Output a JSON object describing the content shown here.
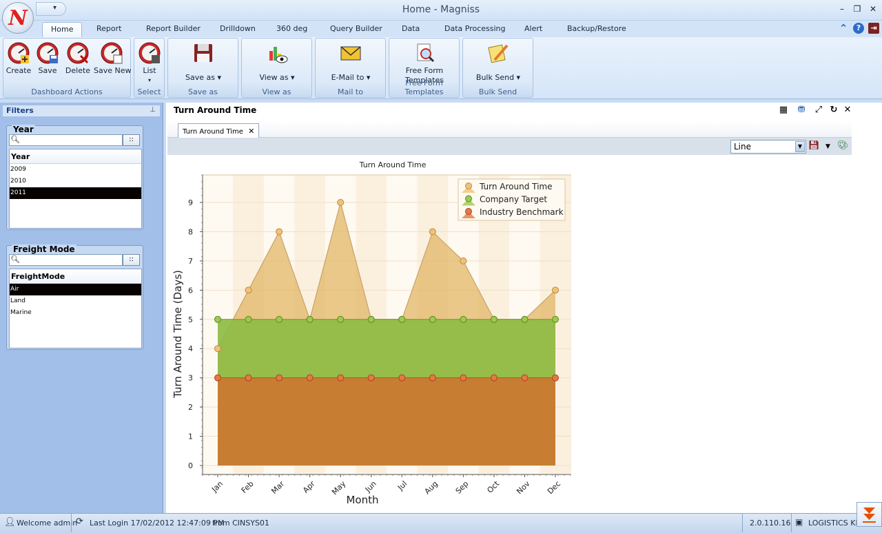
{
  "window": {
    "title": "Home - Magniss",
    "logo_letter": "N",
    "qat_arrow": "▾",
    "min": "–",
    "max": "❐",
    "close": "✕"
  },
  "ribbon_tabs": [
    {
      "label": "Home"
    },
    {
      "label": "Report"
    },
    {
      "label": "Report Builder"
    },
    {
      "label": "Drilldown"
    },
    {
      "label": "360 deg"
    },
    {
      "label": "Query Builder"
    },
    {
      "label": "Data"
    },
    {
      "label": "Data Processing"
    },
    {
      "label": "Alert"
    },
    {
      "label": "Backup/Restore"
    }
  ],
  "ribbon_right_icons": {
    "collapse": "⌃",
    "help": "?",
    "exit": "⇥"
  },
  "ribbon_groups": {
    "dashboard_actions": {
      "label": "Dashboard Actions",
      "create": "Create",
      "save": "Save",
      "delete": "Delete",
      "save_new": "Save New"
    },
    "select": {
      "label": "Select",
      "list": "List",
      "list_arrow": "▾"
    },
    "save_as": {
      "label": "Save as",
      "button": "Save as ▾"
    },
    "view_as": {
      "label": "View as",
      "button": "View as ▾"
    },
    "mail_to": {
      "label": "Mail to",
      "button": "E-Mail to ▾"
    },
    "free_form": {
      "label": "Free Form Templates",
      "button_line1": "Free Form",
      "button_line2": "Templates"
    },
    "bulk_send": {
      "label": "Bulk Send",
      "button": "Bulk Send ▾"
    }
  },
  "filters": {
    "title": "Filters",
    "pin": "⊥",
    "year": {
      "title": "Year",
      "search_placeholder": "",
      "browse": "::",
      "column": "Year",
      "items": [
        "2009",
        "2010",
        "2011"
      ],
      "selected": "2011"
    },
    "freight": {
      "title": "Freight Mode",
      "search_placeholder": "",
      "browse": "::",
      "column": "FreightMode",
      "items": [
        "Air",
        "Land",
        "Marine"
      ],
      "selected": "Air"
    }
  },
  "main": {
    "title": "Turn Around Time",
    "tab": "Turn Around Time",
    "tab_close": "✕",
    "chart_type_value": "Line",
    "tool_icons": {
      "grid": "▦",
      "export": "⛃",
      "expand": "⤢",
      "refresh": "↻",
      "close": "✕"
    }
  },
  "chart_data": {
    "type": "area",
    "title": "Turn Around Time",
    "xlabel": "Month",
    "ylabel": "Turn Around Time (Days)",
    "categories": [
      "Jan",
      "Feb",
      "Mar",
      "Apr",
      "May",
      "Jun",
      "Jul",
      "Aug",
      "Sep",
      "Oct",
      "Nov",
      "Dec"
    ],
    "ylim": [
      0,
      9
    ],
    "yticks": [
      0,
      1,
      2,
      3,
      4,
      5,
      6,
      7,
      8,
      9
    ],
    "legend_position": "top-right",
    "series": [
      {
        "name": "Turn Around Time",
        "color": "#e2b766",
        "values": [
          4,
          6,
          8,
          5,
          9,
          5,
          5,
          8,
          7,
          5,
          5,
          6
        ]
      },
      {
        "name": "Company Target",
        "color": "#8dba43",
        "values": [
          5,
          5,
          5,
          5,
          5,
          5,
          5,
          5,
          5,
          5,
          5,
          5
        ]
      },
      {
        "name": "Industry Benchmark",
        "color": "#c97a32",
        "values": [
          3,
          3,
          3,
          3,
          3,
          3,
          3,
          3,
          3,
          3,
          3,
          3
        ]
      }
    ]
  },
  "status": {
    "welcome": "Welcome admin",
    "last_login": "Last Login 17/02/2012 12:47:09 PM",
    "from": "from CINSYS01",
    "version": "2.0.110.16",
    "company": "LOGISTICS KP"
  }
}
